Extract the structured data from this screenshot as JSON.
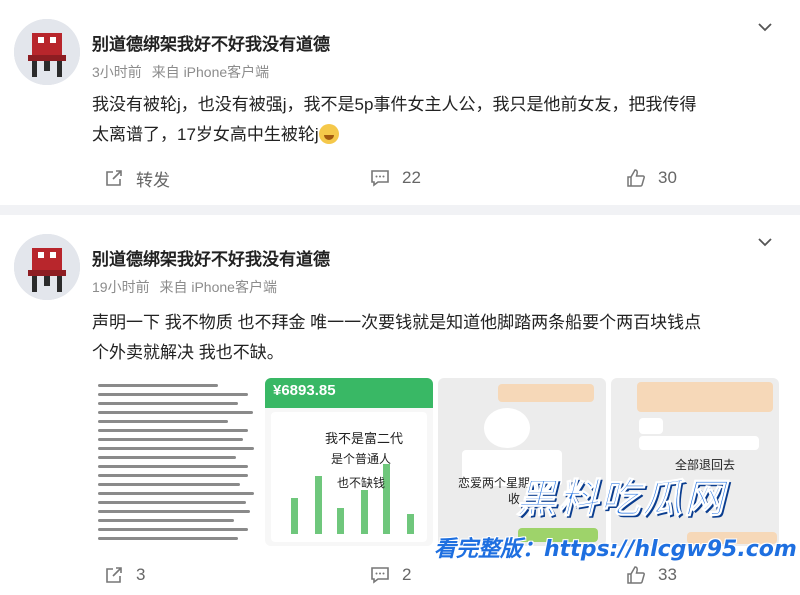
{
  "posts": [
    {
      "author": "别道德绑架我好不好我没有道德",
      "time": "3小时前",
      "source": "来自 iPhone客户端",
      "text_line1": "我没有被轮j，也没有被强j，我不是5p事件女主人公，我只是他前女友，把我传得",
      "text_line2": "太离谱了，17岁女高中生被轮j",
      "emoji": "laugh-cry-emoji",
      "repost_label": "转发",
      "comment_count": "22",
      "like_count": "30"
    },
    {
      "author": "别道德绑架我好不好我没有道德",
      "time": "19小时前",
      "source": "来自 iPhone客户端",
      "text_line1": "声明一下 我不物质 也不拜金 唯一一次要钱就是知道他脚踏两条船要个两百块钱点",
      "text_line2": "个外卖就解决 我也不缺。",
      "repost_count": "3",
      "comment_count": "2",
      "like_count": "33",
      "images": {
        "img2_amount": "¥6893.85",
        "img2_overlay1": "我不是富二代",
        "img2_overlay2": "是个普通人",
        "img2_overlay3": "也不缺钱",
        "img3_text": "恋爱两个星期",
        "img3_text2": "收",
        "img4_text": "全部退回去"
      }
    }
  ],
  "watermark": {
    "title": "黑料吃瓜网",
    "url": "hlcgw95.com",
    "line": "看完整版：https://hlcgw95.com"
  },
  "colors": {
    "accent": "#1e6fe0",
    "wechat_green": "#39b865"
  }
}
